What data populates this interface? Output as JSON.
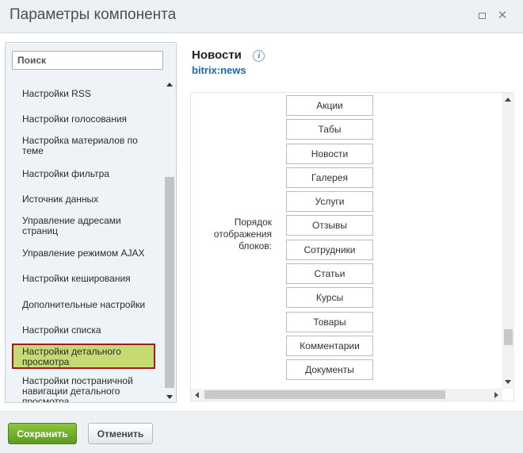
{
  "window": {
    "title": "Параметры компонента",
    "maximize_icon": "maximize-icon",
    "close_icon": "close-icon",
    "close_glyph": "✕"
  },
  "sidebar": {
    "search_placeholder": "Поиск",
    "items": [
      {
        "label": "Настройки RSS"
      },
      {
        "label": "Настройки голосования"
      },
      {
        "label": "Настройка материалов по теме"
      },
      {
        "label": "Настройки фильтра"
      },
      {
        "label": "Источник данных"
      },
      {
        "label": "Управление адресами страниц"
      },
      {
        "label": "Управление режимом AJAX"
      },
      {
        "label": "Настройки кеширования"
      },
      {
        "label": "Дополнительные настройки"
      },
      {
        "label": "Настройки списка"
      },
      {
        "label": "Настройки детального просмотра"
      },
      {
        "label": "Настройки постраничной навигации детального просмотра"
      }
    ],
    "selected_item": "Настройки детального просмотра"
  },
  "component": {
    "title": "Новости",
    "code": "bitrix:news",
    "info_icon": "info-icon",
    "info_glyph": "i"
  },
  "content": {
    "order_label": "Порядок отображения блоков:",
    "blocks": [
      "Акции",
      "Табы",
      "Новости",
      "Галерея",
      "Услуги",
      "Отзывы",
      "Сотрудники",
      "Статьи",
      "Курсы",
      "Товары",
      "Комментарии",
      "Документы"
    ]
  },
  "footer": {
    "save_label": "Сохранить",
    "cancel_label": "Отменить"
  },
  "colors": {
    "selected_bg": "#c6da74",
    "selected_border": "#a01c1c",
    "save_button": "#6fae2a",
    "link_blue": "#2067b0"
  }
}
